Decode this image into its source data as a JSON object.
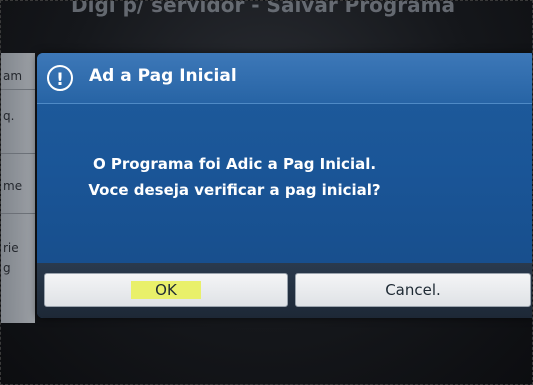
{
  "background": {
    "title": "Digi p/ servidor - Salvar Programa",
    "list_fragments": [
      "am",
      "q.",
      "me",
      "rie",
      "g"
    ]
  },
  "dialog": {
    "title": "Ad a Pag Inicial",
    "icon": "info-icon",
    "message_line1": "O Programa foi Adic a Pag Inicial.",
    "message_line2": "Voce deseja verificar a pag inicial?",
    "ok_label": "OK",
    "cancel_label": "Cancel."
  },
  "colors": {
    "dialog_blue": "#1a5597",
    "header_blue": "#2764a5",
    "ok_highlight": "#e9f06a"
  }
}
